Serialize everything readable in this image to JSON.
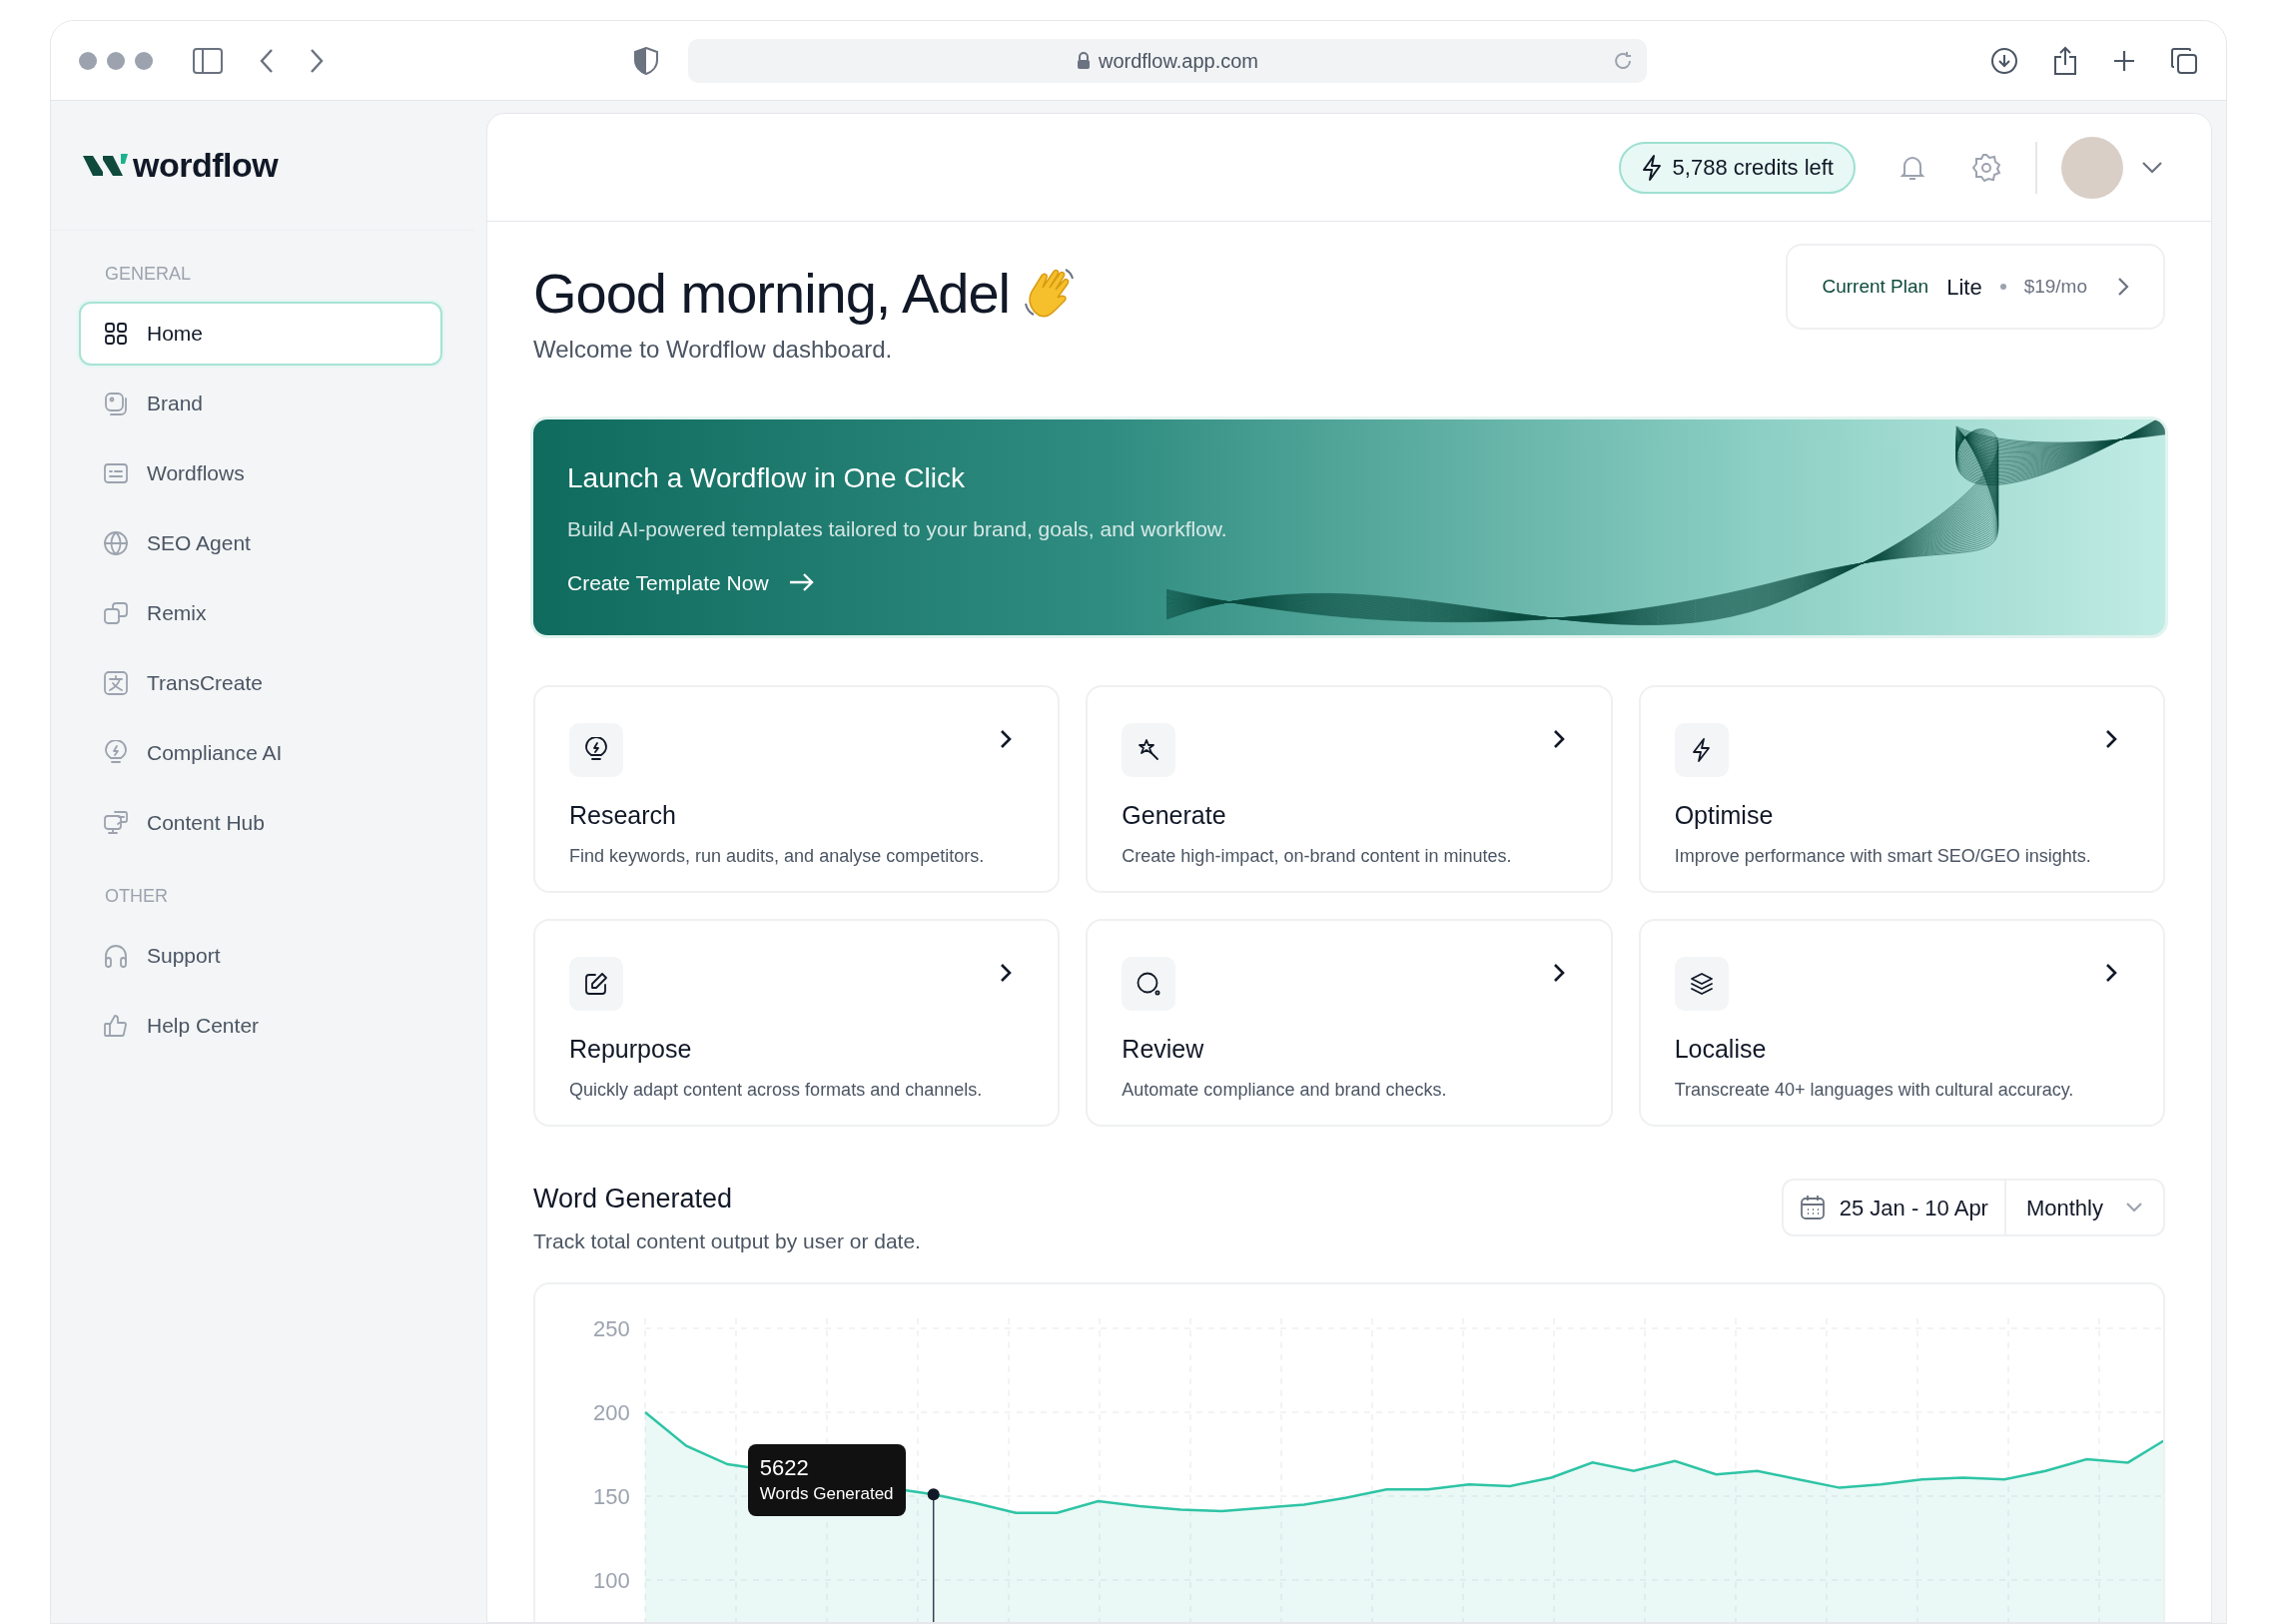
{
  "browser": {
    "url": "wordflow.app.com"
  },
  "sidebar": {
    "logo": "wordflow",
    "sections": [
      {
        "heading": "GENERAL",
        "items": [
          {
            "label": "Home",
            "selected": true
          },
          {
            "label": "Brand",
            "selected": false
          },
          {
            "label": "Wordflows",
            "selected": false
          },
          {
            "label": "SEO Agent",
            "selected": false
          },
          {
            "label": "Remix",
            "selected": false
          },
          {
            "label": "TransCreate",
            "selected": false
          },
          {
            "label": "Compliance AI",
            "selected": false
          },
          {
            "label": "Content Hub",
            "selected": false
          }
        ]
      },
      {
        "heading": "OTHER",
        "items": [
          {
            "label": "Support",
            "selected": false
          },
          {
            "label": "Help Center",
            "selected": false
          }
        ]
      }
    ]
  },
  "header": {
    "credits": "5,788 credits left"
  },
  "greeting": {
    "title": "Good morning, Adel",
    "subtitle": "Welcome to Wordflow dashboard."
  },
  "plan": {
    "label": "Current Plan",
    "name": "Lite",
    "price": "$19/mo"
  },
  "banner": {
    "title": "Launch a Wordflow in One Click",
    "text": "Build AI-powered templates tailored to your brand, goals, and workflow.",
    "cta": "Create Template Now"
  },
  "features": [
    {
      "title": "Research",
      "description": "Find keywords, run audits, and analyse competitors."
    },
    {
      "title": "Generate",
      "description": "Create high-impact, on-brand content in minutes."
    },
    {
      "title": "Optimise",
      "description": "Improve performance with smart SEO/GEO insights."
    },
    {
      "title": "Repurpose",
      "description": "Quickly adapt content across formats and channels."
    },
    {
      "title": "Review",
      "description": "Automate compliance and brand checks."
    },
    {
      "title": "Localise",
      "description": "Transcreate 40+ languages with cultural accuracy."
    }
  ],
  "words": {
    "title": "Word Generated",
    "subtitle": "Track total content output by user or date.",
    "date_range": "25 Jan - 10 Apr",
    "period": "Monthly",
    "chart_data": {
      "type": "area",
      "ylim": [
        100,
        250
      ],
      "yticks": [
        100,
        150,
        200,
        250
      ],
      "grid": true,
      "series": [
        {
          "color": "#2ec4a5",
          "values": [
            200,
            180,
            169,
            null,
            null,
            null,
            null,
            151,
            146,
            140,
            140,
            147,
            144,
            142,
            141,
            143,
            145,
            149,
            154,
            154,
            157,
            156,
            161,
            170,
            165,
            171,
            163,
            165,
            160,
            155,
            157,
            160,
            161,
            160,
            165,
            172,
            170,
            185
          ]
        }
      ],
      "annotations": [
        "5622",
        "Words Generated"
      ]
    }
  }
}
